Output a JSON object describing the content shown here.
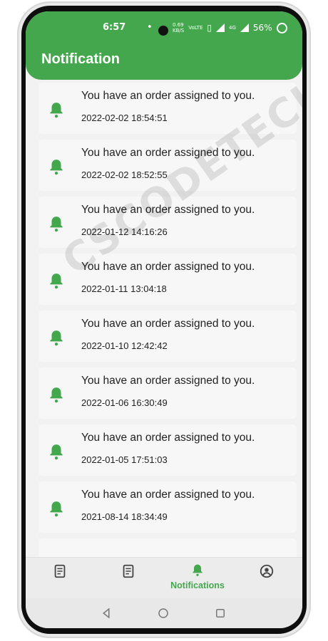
{
  "status_bar": {
    "time": "6:57",
    "speed_value": "0.69",
    "speed_unit": "KB/S",
    "volte": "VoLTE",
    "network": "4G",
    "battery": "56%"
  },
  "header": {
    "title": "Notification"
  },
  "notifications": [
    {
      "message": "You have an order assigned to you.",
      "timestamp": "2022-02-02 18:54:51"
    },
    {
      "message": "You have an order assigned to you.",
      "timestamp": "2022-02-02 18:52:55"
    },
    {
      "message": "You have an order assigned to you.",
      "timestamp": "2022-01-12 14:16:26"
    },
    {
      "message": "You have an order assigned to you.",
      "timestamp": "2022-01-11 13:04:18"
    },
    {
      "message": "You have an order assigned to you.",
      "timestamp": "2022-01-10 12:42:42"
    },
    {
      "message": "You have an order assigned to you.",
      "timestamp": "2022-01-06 16:30:49"
    },
    {
      "message": "You have an order assigned to you.",
      "timestamp": "2022-01-05 17:51:03"
    },
    {
      "message": "You have an order assigned to you.",
      "timestamp": "2021-08-14 18:34:49"
    }
  ],
  "bottom_nav": {
    "items": [
      {
        "icon": "document-icon",
        "label": ""
      },
      {
        "icon": "receipt-icon",
        "label": ""
      },
      {
        "icon": "bell-icon",
        "label": "Notifications",
        "active": true
      },
      {
        "icon": "profile-icon",
        "label": ""
      }
    ]
  },
  "watermark": "CSCODETECH",
  "colors": {
    "accent": "#45a74d",
    "background": "#f2f2f2",
    "card": "#f7f7f7",
    "text": "#222222"
  }
}
